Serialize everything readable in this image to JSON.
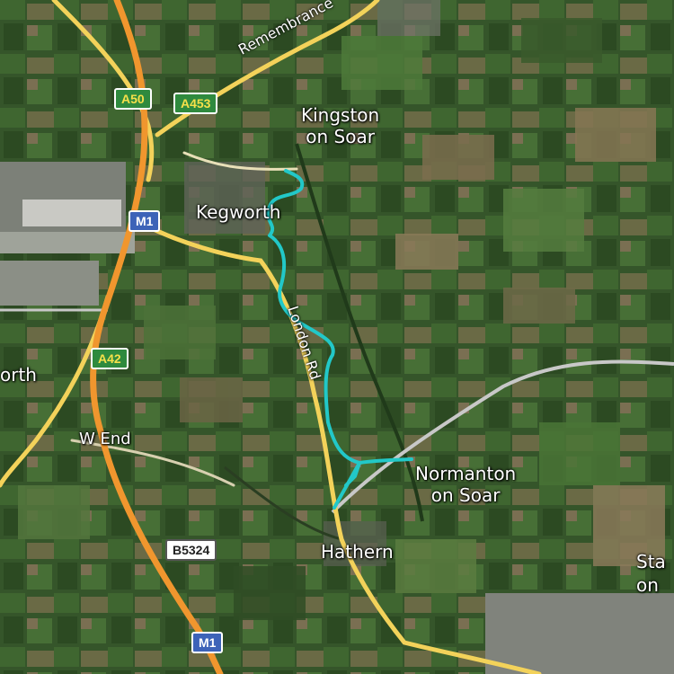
{
  "places": {
    "kingston": "Kingston\non Soar",
    "kegworth": "Kegworth",
    "normanton": "Normanton\non Soar",
    "hathern": "Hathern",
    "w_end": "W End",
    "orth": "orth",
    "sta": "Sta\non"
  },
  "roads": {
    "remembrance": "Remembrance",
    "london_rd": "London Rd"
  },
  "shields": {
    "a50": "A50",
    "a453": "A453",
    "m1_top": "M1",
    "a42": "A42",
    "b5324": "B5324",
    "m1_bottom": "M1"
  },
  "colors": {
    "route": "#22c8c8",
    "motorway": "#f0962e",
    "primary_road": "#f3d25a",
    "railway": "#c8c8c8"
  }
}
